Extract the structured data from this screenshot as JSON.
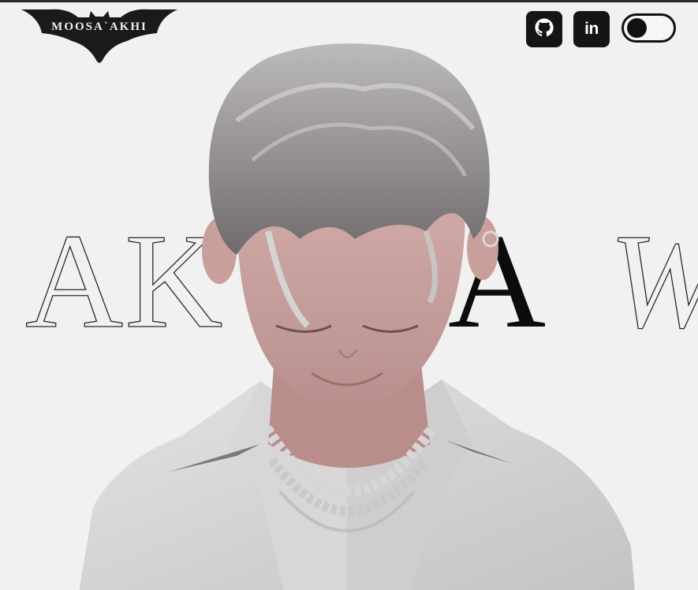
{
  "header": {
    "logo_text": "MOOSA`AKHI",
    "github_icon": "github-icon",
    "linkedin_icon": "linkedin-icon",
    "linkedin_label": "in",
    "theme_toggle": {
      "state": "off"
    }
  },
  "hero": {
    "marquee": {
      "segments": [
        "AK",
        "A",
        "W"
      ]
    },
    "image_subject": "3d-avatar"
  },
  "colors": {
    "background": "#f2f1f2",
    "dark": "#151515",
    "accent_light": "#ffffff"
  }
}
